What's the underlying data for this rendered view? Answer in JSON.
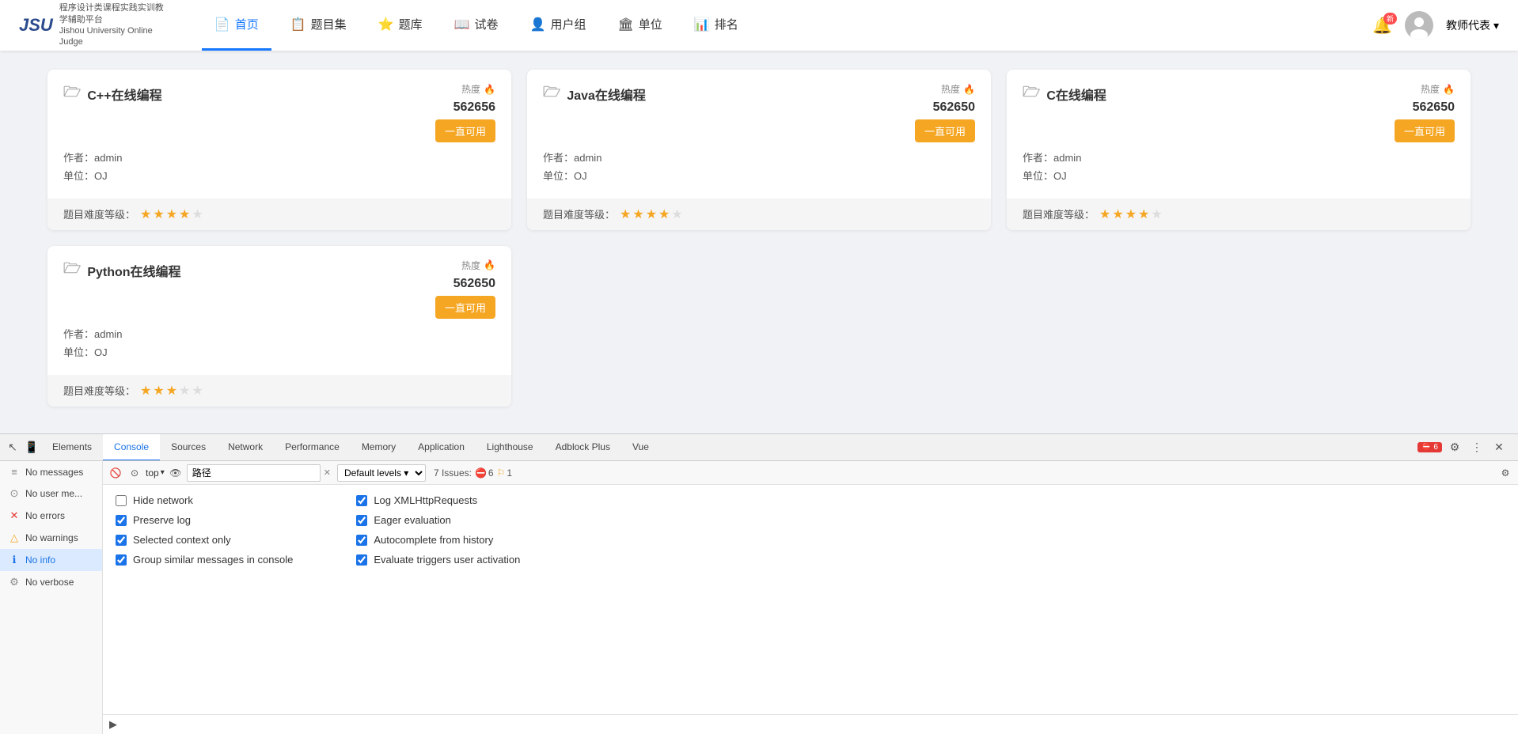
{
  "navbar": {
    "brand_logo": "JSU",
    "brand_main": "程序设计类课程实践实训教学辅助平台",
    "brand_sub": "Jishou University Online Judge",
    "nav_items": [
      {
        "label": "首页",
        "icon": "📄",
        "active": true
      },
      {
        "label": "题目集",
        "icon": "📋",
        "active": false
      },
      {
        "label": "题库",
        "icon": "⭐",
        "active": false
      },
      {
        "label": "试卷",
        "icon": "📖",
        "active": false
      },
      {
        "label": "用户组",
        "icon": "👤",
        "active": false
      },
      {
        "label": "单位",
        "icon": "🏛",
        "active": false
      },
      {
        "label": "排名",
        "icon": "📊",
        "active": false
      }
    ],
    "bell_badge": "新",
    "user_label": "教师代表",
    "user_dropdown": "▾"
  },
  "cards": [
    {
      "title": "C++在线编程",
      "heat_label": "热度",
      "heat_value": "562656",
      "author_label": "作者：",
      "author": "admin",
      "unit_label": "单位：",
      "unit": "OJ",
      "btn_label": "一直可用",
      "difficulty_label": "题目难度等级：",
      "stars": [
        1,
        1,
        1,
        1,
        0
      ]
    },
    {
      "title": "Java在线编程",
      "heat_label": "热度",
      "heat_value": "562650",
      "author_label": "作者：",
      "author": "admin",
      "unit_label": "单位：",
      "unit": "OJ",
      "btn_label": "一直可用",
      "difficulty_label": "题目难度等级：",
      "stars": [
        1,
        1,
        1,
        1,
        0
      ]
    },
    {
      "title": "C在线编程",
      "heat_label": "热度",
      "heat_value": "562650",
      "author_label": "作者：",
      "author": "admin",
      "unit_label": "单位：",
      "unit": "OJ",
      "btn_label": "一直可用",
      "difficulty_label": "题目难度等级：",
      "stars": [
        1,
        1,
        1,
        1,
        0
      ]
    },
    {
      "title": "Python在线编程",
      "heat_label": "热度",
      "heat_value": "562650",
      "author_label": "作者：",
      "author": "admin",
      "unit_label": "单位：",
      "unit": "OJ",
      "btn_label": "一直可用",
      "difficulty_label": "题目难度等级：",
      "stars": [
        1,
        1,
        1,
        0,
        0
      ]
    }
  ],
  "devtools": {
    "tabs": [
      {
        "label": "Elements"
      },
      {
        "label": "Console",
        "active": true
      },
      {
        "label": "Sources"
      },
      {
        "label": "Network"
      },
      {
        "label": "Performance"
      },
      {
        "label": "Memory"
      },
      {
        "label": "Application"
      },
      {
        "label": "Lighthouse"
      },
      {
        "label": "Adblock Plus"
      },
      {
        "label": "Vue"
      }
    ],
    "error_count": "6",
    "issues_label": "7 Issues:",
    "warn_count": "1",
    "console_filter_placeholder": "路径",
    "level_label": "Default levels",
    "sidebar_items": [
      {
        "icon": "≡",
        "label": "No messages",
        "type": "msg"
      },
      {
        "icon": "⊙",
        "label": "No user me...",
        "type": "user"
      },
      {
        "icon": "✕",
        "label": "No errors",
        "type": "error"
      },
      {
        "icon": "△",
        "label": "No warnings",
        "type": "warn"
      },
      {
        "icon": "ℹ",
        "label": "No info",
        "type": "info",
        "active": true
      },
      {
        "icon": "⚙",
        "label": "No verbose",
        "type": "verbose"
      }
    ],
    "top_context": "top",
    "options": {
      "col1": [
        {
          "label": "Hide network",
          "checked": false
        },
        {
          "label": "Preserve log",
          "checked": true
        },
        {
          "label": "Selected context only",
          "checked": true
        },
        {
          "label": "Group similar messages in console",
          "checked": true
        }
      ],
      "col2": [
        {
          "label": "Log XMLHttpRequests",
          "checked": true
        },
        {
          "label": "Eager evaluation",
          "checked": true
        },
        {
          "label": "Autocomplete from history",
          "checked": true
        },
        {
          "label": "Evaluate triggers user activation",
          "checked": true
        }
      ]
    }
  }
}
